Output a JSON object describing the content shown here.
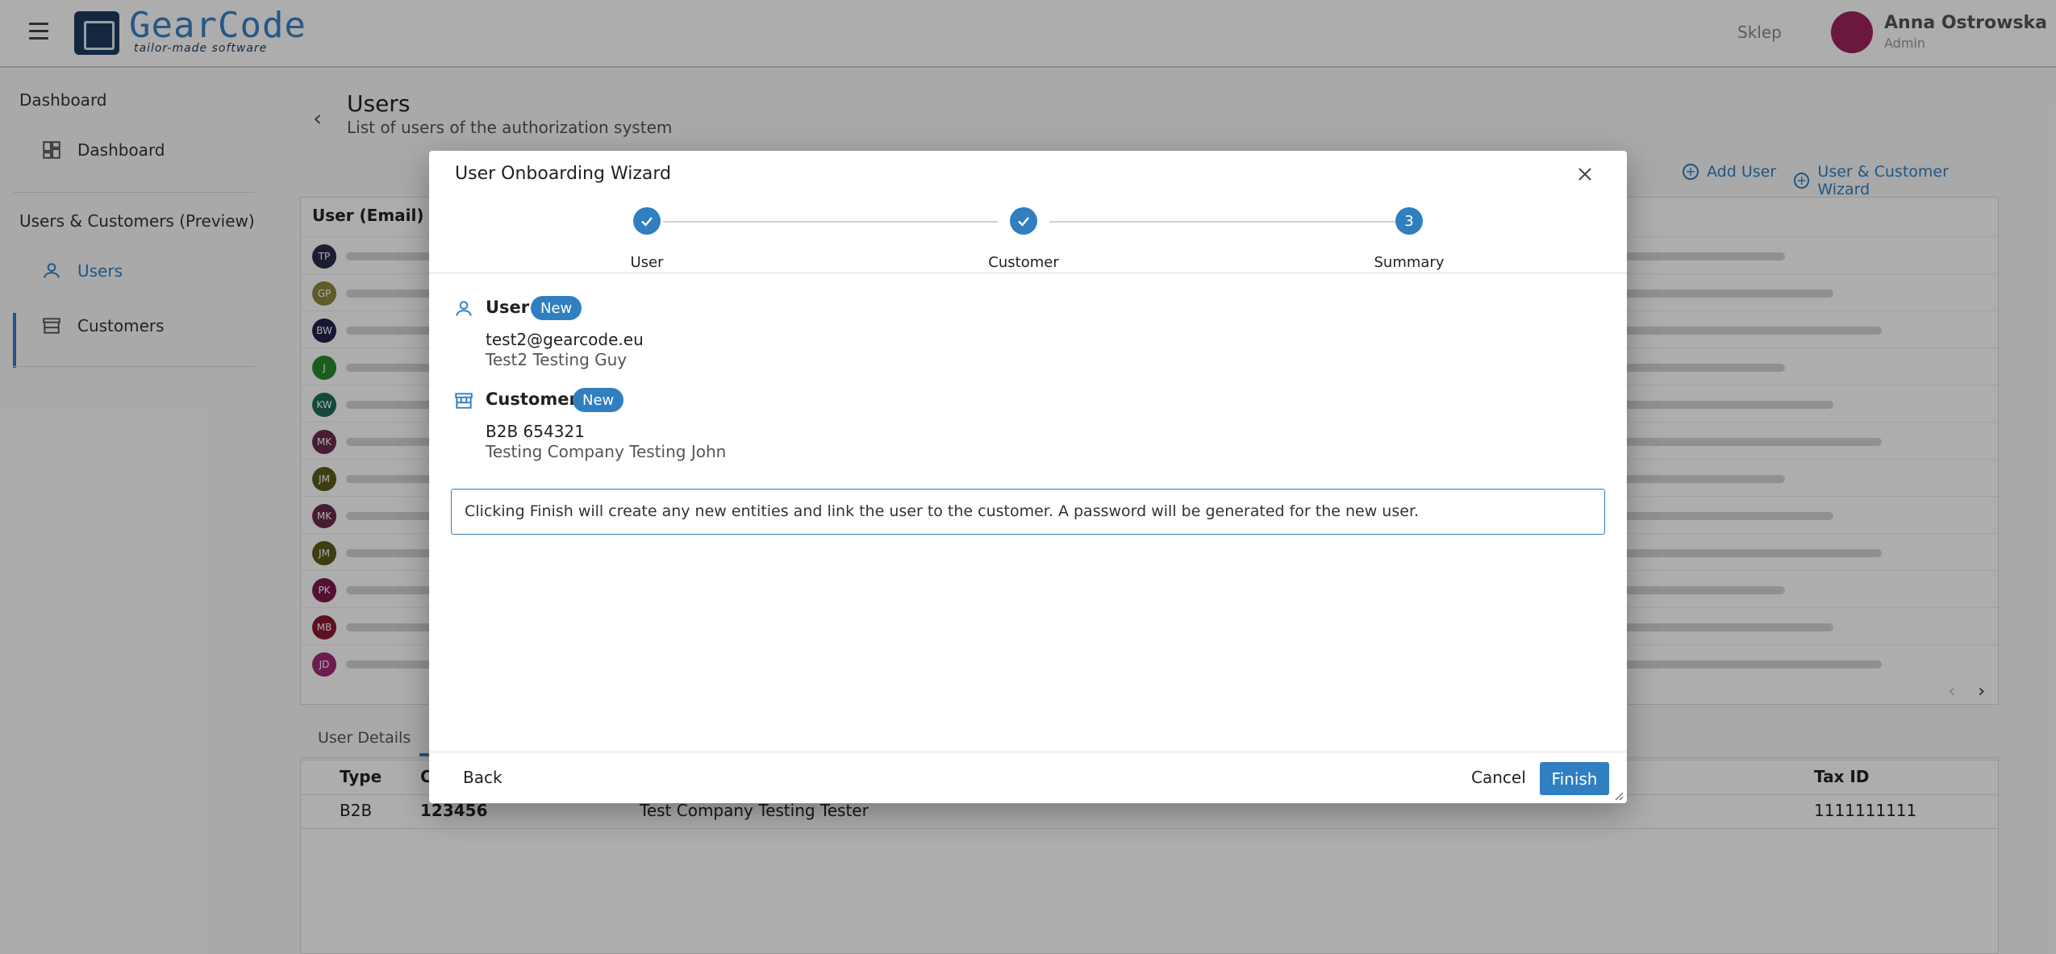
{
  "app": {
    "brand_name": "GearCode",
    "brand_tagline": "tailor-made software",
    "top_link": "Sklep",
    "top_user_name": "Anna Ostrowska",
    "top_user_role": "Admin"
  },
  "sidebar": {
    "section_dashboard": "Dashboard",
    "item_dashboard": "Dashboard",
    "section_users_customers": "Users & Customers (Preview)",
    "item_users": "Users",
    "item_customers": "Customers"
  },
  "page": {
    "title": "Users",
    "subtitle": "List of users of the authorization system",
    "add_user": "Add User",
    "wizard_button": "User & Customer Wizard",
    "grid_header": "User (Email)",
    "avatars": [
      {
        "initials": "TP",
        "color": "#2a2a4a"
      },
      {
        "initials": "GP",
        "color": "#8a8a3a"
      },
      {
        "initials": "BW",
        "color": "#22224a"
      },
      {
        "initials": "J",
        "color": "#2a8a2a"
      },
      {
        "initials": "KW",
        "color": "#1e6a5a"
      },
      {
        "initials": "MK",
        "color": "#6a2a4a"
      },
      {
        "initials": "JM",
        "color": "#5a5a1a"
      },
      {
        "initials": "MK",
        "color": "#6a2a4a"
      },
      {
        "initials": "JM",
        "color": "#5a5a1a"
      },
      {
        "initials": "PK",
        "color": "#7a1a4a"
      },
      {
        "initials": "MB",
        "color": "#8a1a2a"
      },
      {
        "initials": "JD",
        "color": "#a02a7a"
      }
    ],
    "details_tab": "User Details",
    "details_headers": {
      "type": "Type",
      "code": "C",
      "tax_id": "Tax ID"
    },
    "details_row": {
      "type": "B2B",
      "code": "123456",
      "name": "Test Company Testing Tester",
      "tax_id": "1111111111"
    }
  },
  "wizard": {
    "title": "User Onboarding Wizard",
    "steps": [
      {
        "label": "User",
        "state": "done"
      },
      {
        "label": "Customer",
        "state": "done"
      },
      {
        "label": "Summary",
        "number": "3",
        "state": "active"
      }
    ],
    "user_section": {
      "title": "User",
      "badge": "New",
      "email": "test2@gearcode.eu",
      "name": "Test2 Testing Guy"
    },
    "customer_section": {
      "title": "Customer",
      "badge": "New",
      "code": "B2B 654321",
      "name": "Testing Company Testing John"
    },
    "info_message": "Clicking Finish will create any new entities and link the user to the customer. A password will be generated for the new user.",
    "back_label": "Back",
    "cancel_label": "Cancel",
    "finish_label": "Finish"
  },
  "colors": {
    "accent": "#2f7fc1",
    "overlay": "rgba(0,0,0,0.32)"
  }
}
